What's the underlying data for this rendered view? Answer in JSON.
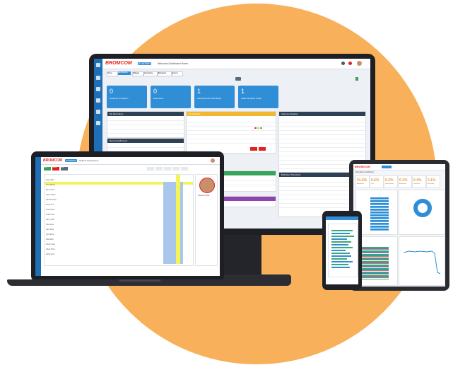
{
  "brand": {
    "name": "BROMCOM",
    "pill": "ACADEMY"
  },
  "monitor": {
    "page_title": "Welcome Dashboard Home",
    "tabs": [
      "Home",
      "Dashboards",
      "Widgets",
      "Attendance",
      "Behaviour",
      "Exams"
    ],
    "tiles": [
      {
        "value": "0",
        "label": "Students On Report"
      },
      {
        "value": "0",
        "label": "Detentions"
      },
      {
        "value": "1",
        "label": "Achievements This Week"
      },
      {
        "value": "1",
        "label": "Class Students Today"
      }
    ],
    "panels": {
      "left_top": {
        "title": "My Reminders"
      },
      "mid_top": {
        "title": "My Students"
      },
      "right": {
        "title": "Absence Register"
      },
      "left_bottom": {
        "title": "Recent Staff Cover"
      },
      "mid_bottom": {
        "title": "Birthdays This Week"
      }
    }
  },
  "laptop": {
    "page_title": "Student Assessment",
    "buttons": [
      "Save",
      "Cancel",
      "Print"
    ],
    "student_rows": [
      "Adam Bell",
      "Alice Brown",
      "Ben Carter",
      "Chloe Davis",
      "Daniel Evans",
      "Emily Fox",
      "Finn Green",
      "Grace Hall",
      "Harry Irwin",
      "Isla Jones",
      "Jack King",
      "Lily Moore",
      "Mia Nash",
      "Noah Owen",
      "Olivia Price",
      "Ruby Scott"
    ],
    "profile_label": "Student Profile"
  },
  "tablet": {
    "header_title": "Attendance Dashboard",
    "stats": [
      {
        "value": "91.6%",
        "label": "Attendance"
      },
      {
        "value": "0.5%",
        "label": "Late"
      },
      {
        "value": "0.2%",
        "label": "Unauthorised"
      },
      {
        "value": "0.1%",
        "label": "Authorised"
      },
      {
        "value": "0.4%",
        "label": "Persistent"
      },
      {
        "value": "0.1%",
        "label": "Exclusions"
      }
    ],
    "accent": "#f29a38"
  },
  "colors": {
    "blob": "#f8b05a",
    "primary": "#2f8ed6",
    "sidebar": "#1e6fb5",
    "highlight": "#f5f35a"
  }
}
